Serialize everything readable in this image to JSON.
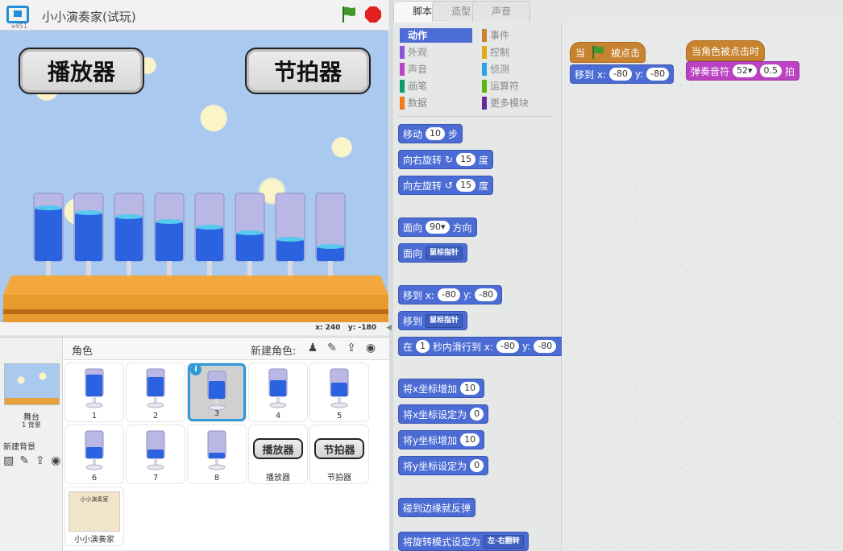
{
  "header": {
    "version": "v451",
    "project_title": "小小演奏家(试玩)"
  },
  "stage": {
    "button_player": "播放器",
    "button_metronome": "节拍器",
    "glass_fill_levels": [
      0.78,
      0.72,
      0.66,
      0.58,
      0.5,
      0.42,
      0.32,
      0.22
    ],
    "coords": {
      "x_label": "x:",
      "x": "240",
      "y_label": "y:",
      "y": "-180"
    }
  },
  "sprite_pane": {
    "sprites_label": "角色",
    "new_sprite_label": "新建角色:",
    "stage_label": "舞台",
    "bg_count": "1 背景",
    "new_bg_label": "新建背景",
    "sprites": [
      {
        "name": "1",
        "fill": 0.78
      },
      {
        "name": "2",
        "fill": 0.72
      },
      {
        "name": "3",
        "fill": 0.66,
        "selected": true
      },
      {
        "name": "4",
        "fill": 0.58
      },
      {
        "name": "5",
        "fill": 0.5
      },
      {
        "name": "6",
        "fill": 0.42
      },
      {
        "name": "7",
        "fill": 0.32
      },
      {
        "name": "8",
        "fill": 0.22
      },
      {
        "name": "播放器",
        "button": "播放器"
      },
      {
        "name": "节拍器",
        "button": "节拍器"
      },
      {
        "name": "小小演奏家",
        "sheet": "小小演奏家"
      }
    ]
  },
  "tabs": [
    "脚本",
    "造型",
    "声音"
  ],
  "categories": [
    {
      "label": "动作",
      "color": "#4a6cd4",
      "active": true
    },
    {
      "label": "事件",
      "color": "#c88330"
    },
    {
      "label": "外观",
      "color": "#8a55d7"
    },
    {
      "label": "控制",
      "color": "#e1a91a"
    },
    {
      "label": "声音",
      "color": "#bb42c3"
    },
    {
      "label": "侦测",
      "color": "#2ca5e2"
    },
    {
      "label": "画笔",
      "color": "#0e9a6c"
    },
    {
      "label": "运算符",
      "color": "#5cb712"
    },
    {
      "label": "数据",
      "color": "#ee7d16"
    },
    {
      "label": "更多模块",
      "color": "#632d99"
    }
  ],
  "palette_blocks": {
    "move": {
      "label": "移动",
      "value": "10",
      "suffix": "步"
    },
    "turn_right": {
      "label": "向右旋转",
      "value": "15",
      "suffix": "度"
    },
    "turn_left": {
      "label": "向左旋转",
      "value": "15",
      "suffix": "度"
    },
    "point_dir": {
      "label": "面向",
      "value": "90▾",
      "suffix": "方向"
    },
    "point_towards": {
      "label": "面向",
      "dropdown": "鼠标指针"
    },
    "goto_xy": {
      "label": "移到 x:",
      "x": "-80",
      "ylabel": "y:",
      "y": "-80"
    },
    "goto": {
      "label": "移到",
      "dropdown": "鼠标指针"
    },
    "glide": {
      "label": "在",
      "secs": "1",
      "mid": "秒内滑行到 x:",
      "x": "-80",
      "ylabel": "y:",
      "y": "-80"
    },
    "change_x": {
      "label": "将x坐标增加",
      "value": "10"
    },
    "set_x": {
      "label": "将x坐标设定为",
      "value": "0"
    },
    "change_y": {
      "label": "将y坐标增加",
      "value": "10"
    },
    "set_y": {
      "label": "将y坐标设定为",
      "value": "0"
    },
    "bounce": {
      "label": "碰到边缘就反弹"
    },
    "rotation_style": {
      "label": "将旋转模式设定为",
      "dropdown": "左-右翻转"
    }
  },
  "scripts": {
    "hat1": {
      "prefix": "当",
      "suffix": "被点击"
    },
    "goto1": {
      "label": "移到 x:",
      "x": "-80",
      "ylabel": "y:",
      "y": "-80"
    },
    "hat2": {
      "label": "当角色被点击时"
    },
    "play_note": {
      "label": "弹奏音符",
      "note": "52▾",
      "beats": "0.5",
      "suffix": "拍"
    }
  },
  "colors": {
    "motion": "#4b6cd4",
    "events": "#c88330",
    "sound": "#bb42c3",
    "accent": "#2f9ad8"
  }
}
